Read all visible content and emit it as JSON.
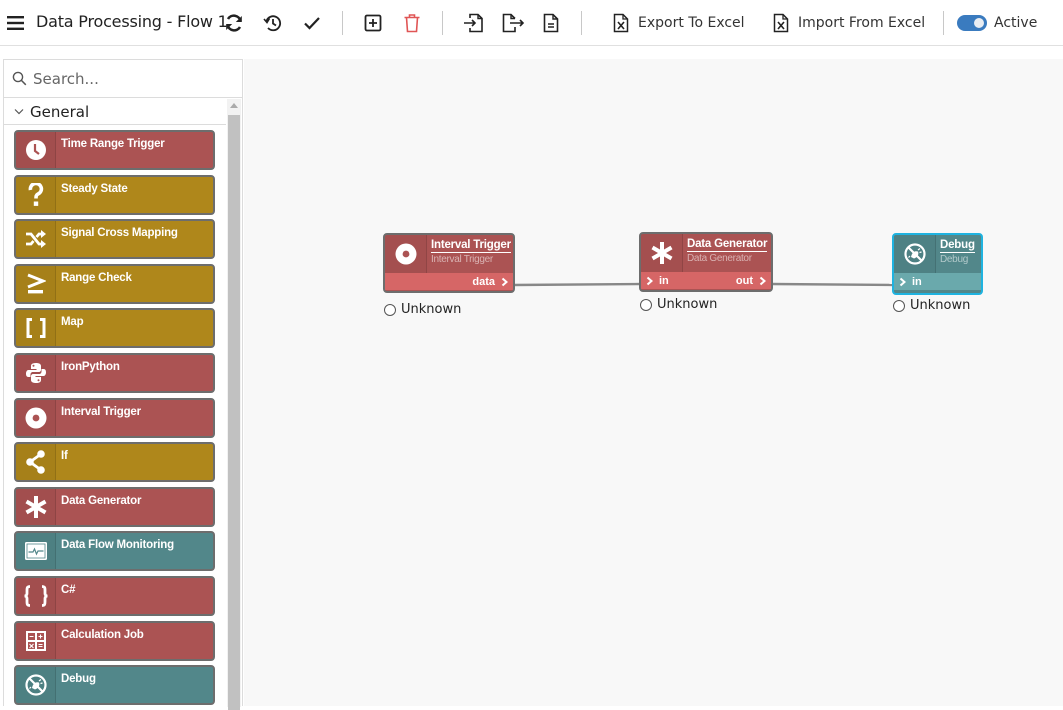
{
  "header": {
    "title": "Data Processing - Flow 1",
    "menu_icon": "hamburger-menu-icon",
    "actions": [
      {
        "name": "refresh",
        "icon": "refresh-icon"
      },
      {
        "name": "history",
        "icon": "history-icon"
      },
      {
        "name": "validate",
        "icon": "checkmark-icon"
      },
      {
        "name": "add",
        "icon": "add-box-icon"
      },
      {
        "name": "delete",
        "icon": "trash-icon"
      },
      {
        "name": "import",
        "icon": "file-import-icon"
      },
      {
        "name": "export",
        "icon": "file-export-icon"
      },
      {
        "name": "document",
        "icon": "document-icon"
      }
    ],
    "export_excel_label": "Export To Excel",
    "import_excel_label": "Import From Excel",
    "active_toggle": {
      "label": "Active",
      "on": true
    },
    "colors": {
      "accent": "#3a7bbf",
      "delete": "#e05555"
    }
  },
  "sidebar": {
    "search_placeholder": "Search...",
    "group": "General",
    "items": [
      {
        "label": "Time Range Trigger",
        "icon": "clock-icon",
        "color": "red"
      },
      {
        "label": "Steady State",
        "icon": "question-icon",
        "color": "gold"
      },
      {
        "label": "Signal Cross Mapping",
        "icon": "shuffle-icon",
        "color": "gold"
      },
      {
        "label": "Range Check",
        "icon": "greater-equal-icon",
        "color": "gold"
      },
      {
        "label": "Map",
        "icon": "brackets-icon",
        "color": "gold"
      },
      {
        "label": "IronPython",
        "icon": "python-icon",
        "color": "red"
      },
      {
        "label": "Interval Trigger",
        "icon": "interval-dot-icon",
        "color": "red"
      },
      {
        "label": "If",
        "icon": "share-branch-icon",
        "color": "gold"
      },
      {
        "label": "Data Generator",
        "icon": "asterisk-icon",
        "color": "red"
      },
      {
        "label": "Data Flow Monitoring",
        "icon": "monitor-pulse-icon",
        "color": "teal"
      },
      {
        "label": "C#",
        "icon": "curly-braces-icon",
        "color": "red"
      },
      {
        "label": "Calculation Job",
        "icon": "calculator-icon",
        "color": "red"
      },
      {
        "label": "Debug",
        "icon": "bug-off-icon",
        "color": "teal"
      }
    ],
    "colors": {
      "red": "#ab5353",
      "gold": "#af871b",
      "teal": "#52878a"
    }
  },
  "canvas": {
    "nodes": [
      {
        "title": "Interval Trigger",
        "subtitle": "Interval Trigger",
        "icon": "interval-dot-icon",
        "color": "red",
        "in_port": null,
        "out_port": "data",
        "status": "Unknown"
      },
      {
        "title": "Data Generator",
        "subtitle": "Data Generator",
        "icon": "asterisk-icon",
        "color": "red",
        "in_port": "in",
        "out_port": "out",
        "status": "Unknown"
      },
      {
        "title": "Debug",
        "subtitle": "Debug",
        "icon": "bug-off-icon",
        "color": "teal",
        "in_port": "in",
        "out_port": null,
        "status": "Unknown",
        "selected": true
      }
    ],
    "connections": [
      {
        "from": "Interval Trigger.data",
        "to": "Data Generator.in"
      },
      {
        "from": "Data Generator.out",
        "to": "Debug.in"
      }
    ]
  }
}
